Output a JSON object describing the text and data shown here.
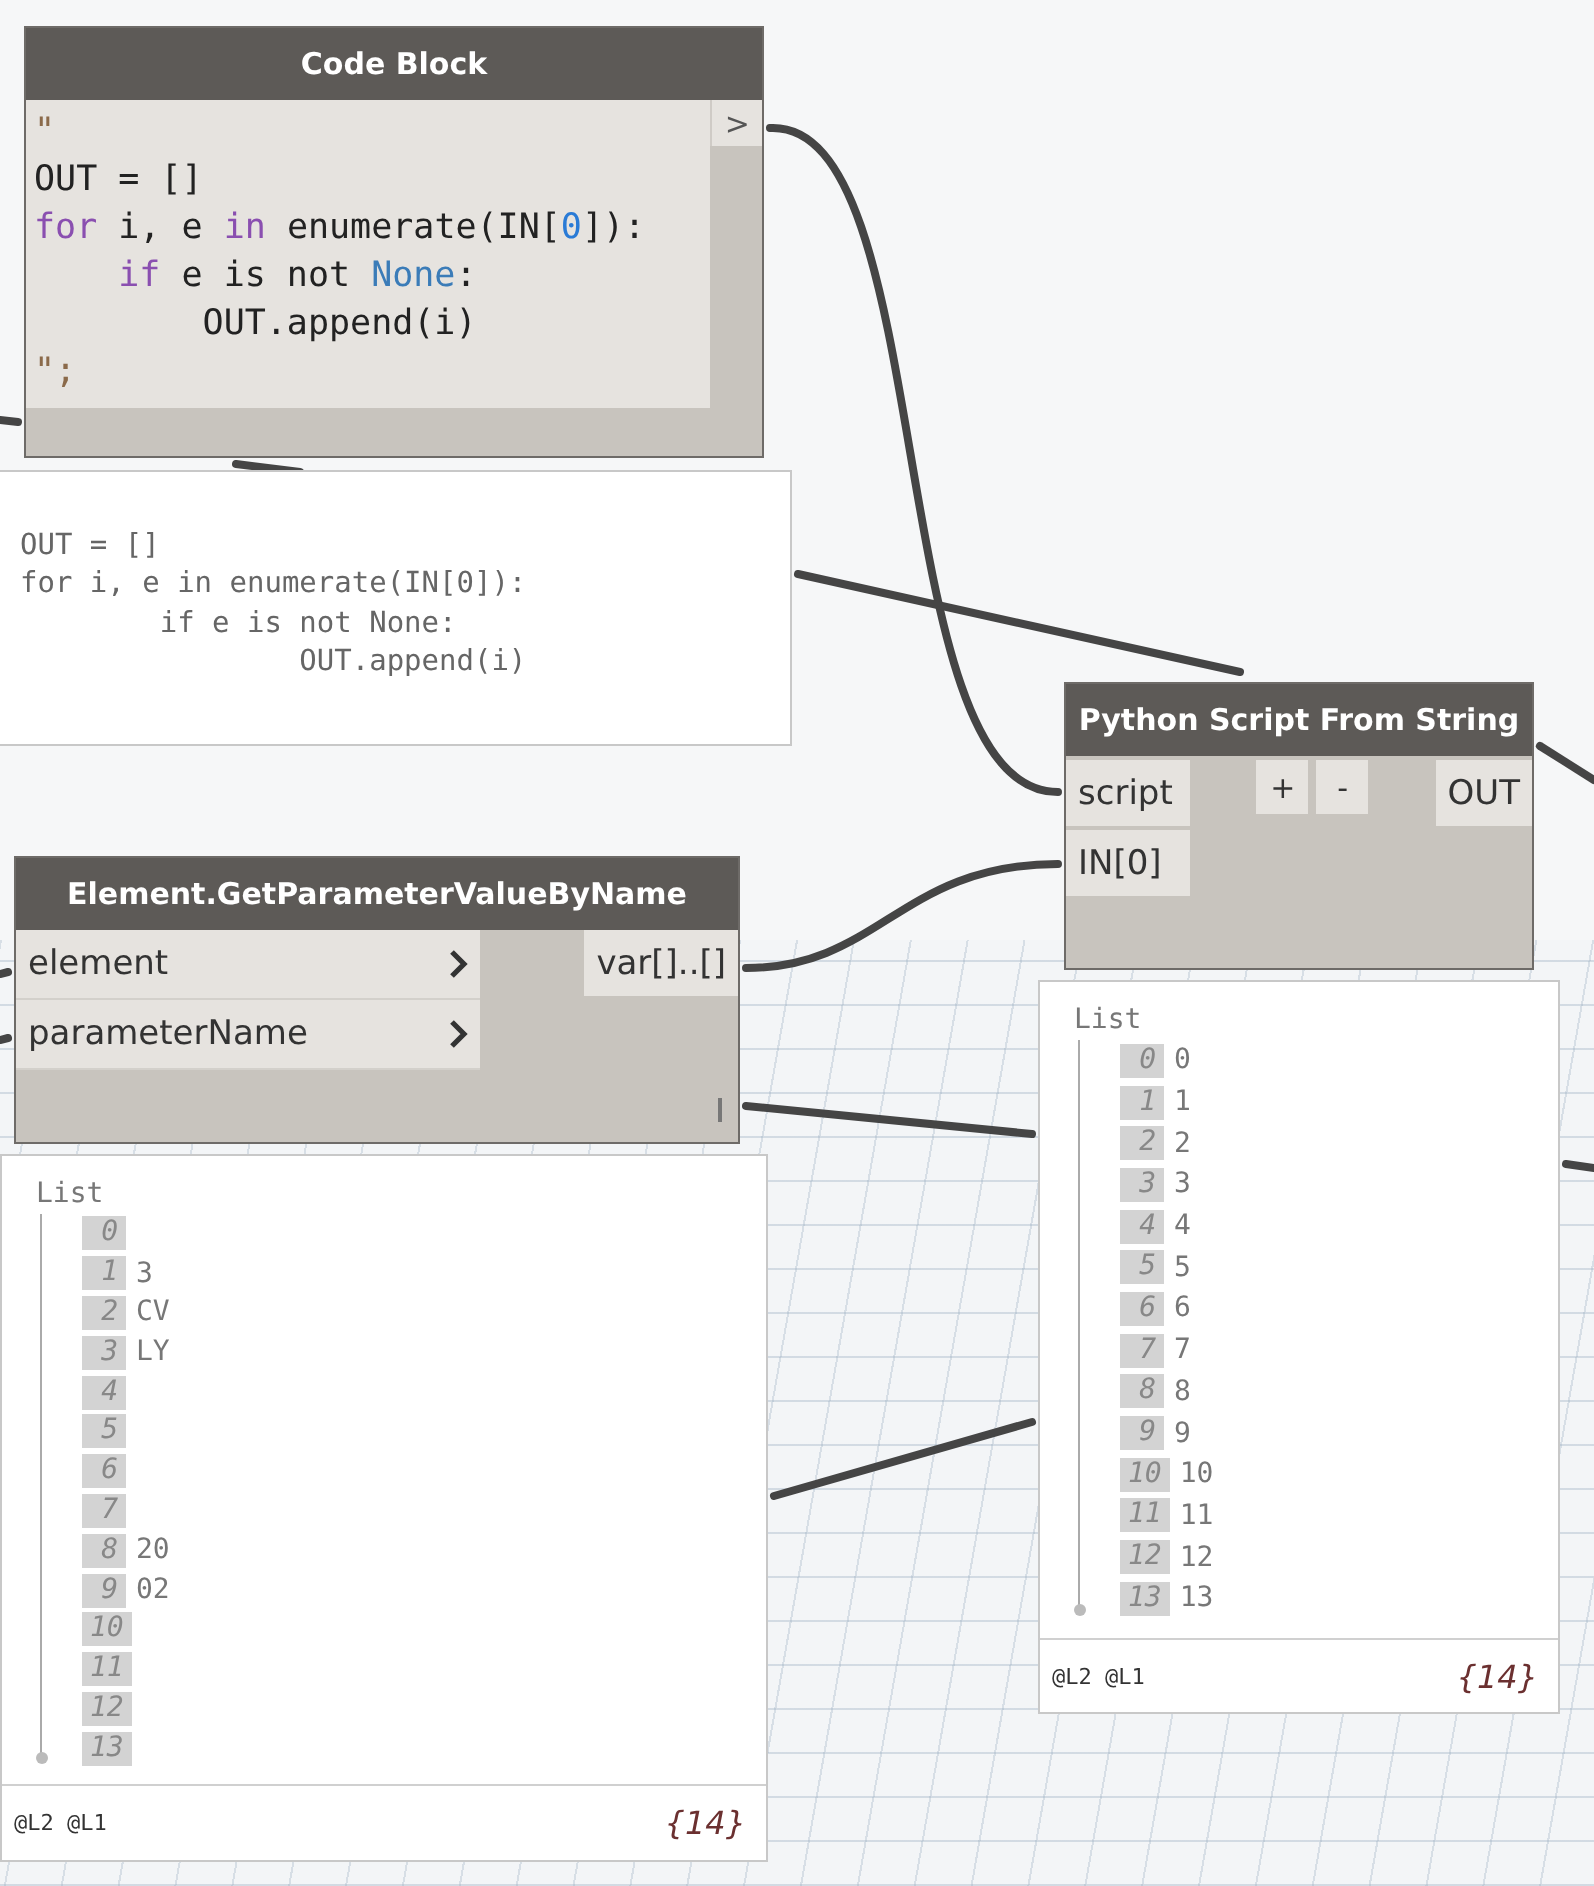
{
  "code_block": {
    "title": "Code Block",
    "output": ">",
    "code": [
      [
        {
          "kind": "string",
          "text": "\""
        }
      ],
      [
        {
          "kind": "plain",
          "text": "OUT = []"
        }
      ],
      [
        {
          "kind": "keyword",
          "text": "for"
        },
        {
          "kind": "plain",
          "text": " i, e "
        },
        {
          "kind": "keyword",
          "text": "in"
        },
        {
          "kind": "plain",
          "text": " enumerate(IN["
        },
        {
          "kind": "number",
          "text": "0"
        },
        {
          "kind": "plain",
          "text": "]):"
        }
      ],
      [
        {
          "kind": "keyword",
          "text": "    if"
        },
        {
          "kind": "plain",
          "text": " e is not "
        },
        {
          "kind": "constant",
          "text": "None"
        },
        {
          "kind": "plain",
          "text": ":"
        }
      ],
      [
        {
          "kind": "plain",
          "text": "        OUT.append(i)"
        }
      ],
      [
        {
          "kind": "string",
          "text": "\";"
        }
      ]
    ]
  },
  "code_preview": {
    "lines": [
      "OUT = []",
      "for i, e in enumerate(IN[0]):",
      "        if e is not None:",
      "                OUT.append(i)"
    ]
  },
  "python_node": {
    "title": "Python Script From String",
    "inputs": [
      "script",
      "IN[0]"
    ],
    "buttons": [
      "+",
      "-"
    ],
    "output": "OUT"
  },
  "element_node": {
    "title": "Element.GetParameterValueByName",
    "inputs": [
      "element",
      "parameterName"
    ],
    "output": "var[]..[]"
  },
  "element_preview": {
    "header": "List",
    "items": [
      {
        "index": "0"
      },
      {
        "index": "1",
        "value": "3"
      },
      {
        "index": "2",
        "value": "CV"
      },
      {
        "index": "3",
        "value": "LY"
      },
      {
        "index": "4"
      },
      {
        "index": "5"
      },
      {
        "index": "6"
      },
      {
        "index": "7"
      },
      {
        "index": "8",
        "value": "20"
      },
      {
        "index": "9",
        "value": "02"
      },
      {
        "index": "10"
      },
      {
        "index": "11"
      },
      {
        "index": "12"
      },
      {
        "index": "13"
      }
    ],
    "levels": "@L2 @L1",
    "count": "{14}"
  },
  "python_preview": {
    "header": "List",
    "items": [
      {
        "index": "0",
        "value": "0"
      },
      {
        "index": "1",
        "value": "1"
      },
      {
        "index": "2",
        "value": "2"
      },
      {
        "index": "3",
        "value": "3"
      },
      {
        "index": "4",
        "value": "4"
      },
      {
        "index": "5",
        "value": "5"
      },
      {
        "index": "6",
        "value": "6"
      },
      {
        "index": "7",
        "value": "7"
      },
      {
        "index": "8",
        "value": "8"
      },
      {
        "index": "9",
        "value": "9"
      },
      {
        "index": "10",
        "value": "10"
      },
      {
        "index": "11",
        "value": "11"
      },
      {
        "index": "12",
        "value": "12"
      },
      {
        "index": "13",
        "value": "13"
      }
    ],
    "levels": "@L2 @L1",
    "count": "{14}"
  }
}
